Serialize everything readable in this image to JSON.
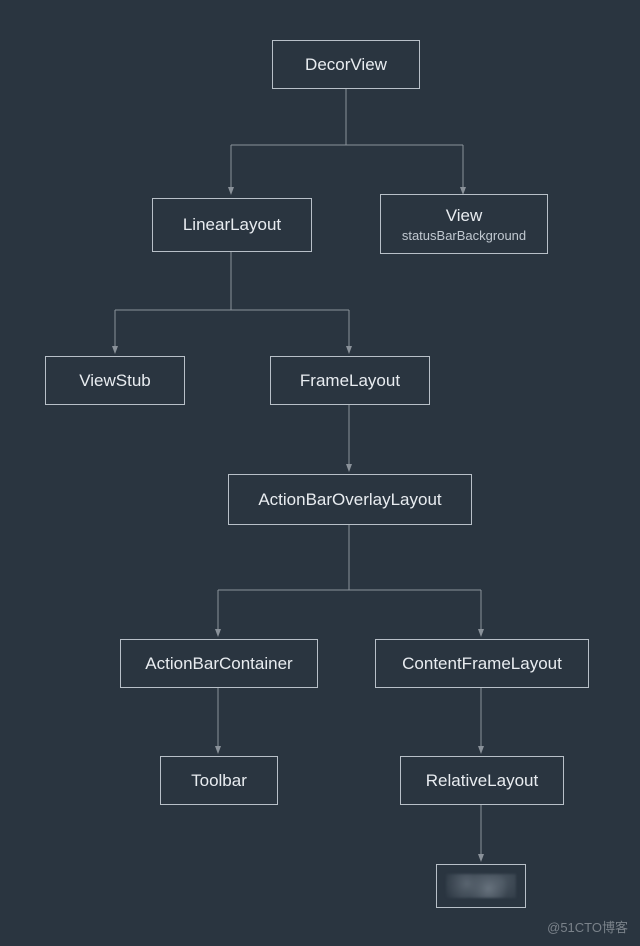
{
  "nodes": {
    "decorView": {
      "label": "DecorView"
    },
    "linearLayout": {
      "label": "LinearLayout"
    },
    "view": {
      "label": "View",
      "sub": "statusBarBackground"
    },
    "viewStub": {
      "label": "ViewStub"
    },
    "frameLayout": {
      "label": "FrameLayout"
    },
    "actionBarOverlay": {
      "label": "ActionBarOverlayLayout"
    },
    "actionBarContainer": {
      "label": "ActionBarContainer"
    },
    "contentFrame": {
      "label": "ContentFrameLayout"
    },
    "toolbar": {
      "label": "Toolbar"
    },
    "relativeLayout": {
      "label": "RelativeLayout"
    }
  },
  "watermark": "@51CTO博客"
}
